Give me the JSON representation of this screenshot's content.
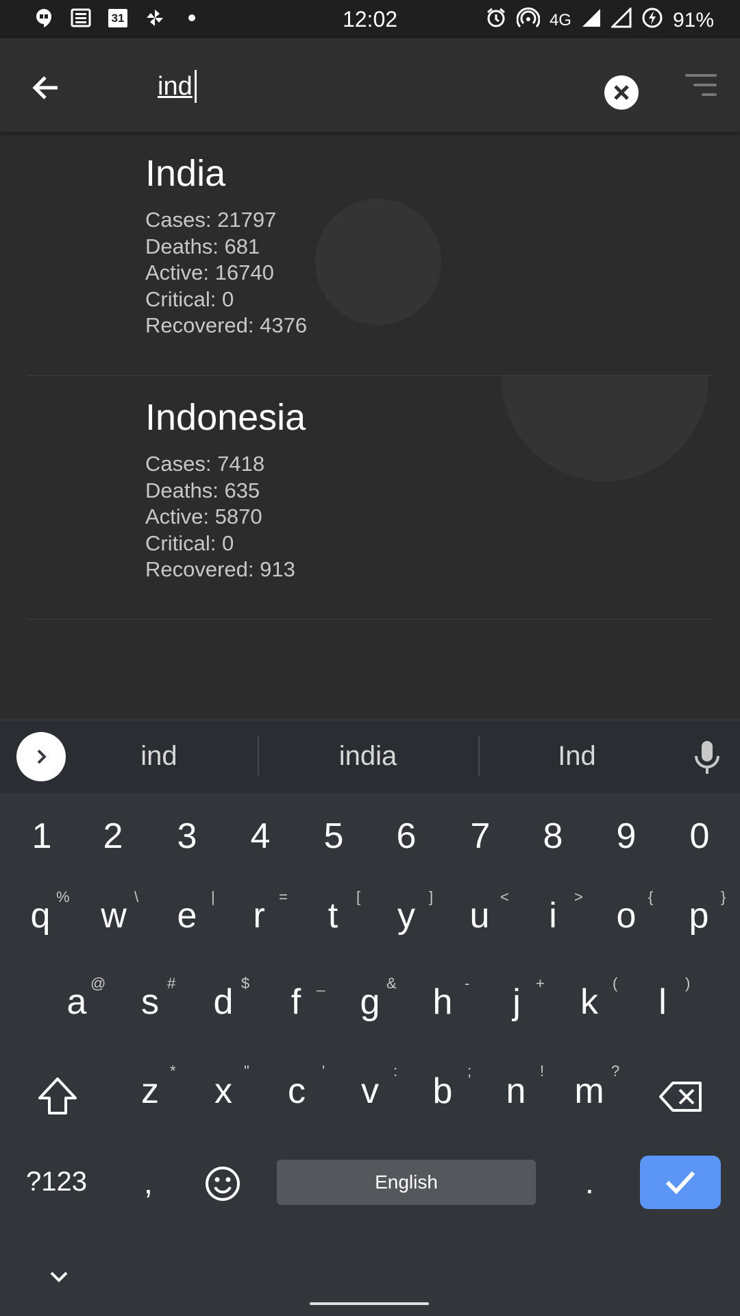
{
  "status_bar": {
    "time": "12:02",
    "network": "4G",
    "battery": "91%",
    "left_icons": [
      "hangouts-icon",
      "news-icon",
      "calendar-icon",
      "pinwheel-icon",
      "dot-icon"
    ],
    "calendar_day": "31"
  },
  "toolbar": {
    "search_value": "ind",
    "back_icon": "arrow-left-icon",
    "clear_icon": "close-circle-icon",
    "sort_icon": "sort-icon"
  },
  "results": [
    {
      "name": "India",
      "cases": "Cases: 21797",
      "deaths": "Deaths: 681",
      "active": "Active: 16740",
      "critical": "Critical: 0",
      "recovered": "Recovered: 4376"
    },
    {
      "name": "Indonesia",
      "cases": "Cases: 7418",
      "deaths": "Deaths: 635",
      "active": "Active: 5870",
      "critical": "Critical: 0",
      "recovered": "Recovered: 913"
    }
  ],
  "keyboard": {
    "suggestions": [
      "ind",
      "india",
      "Ind"
    ],
    "number_row": [
      "1",
      "2",
      "3",
      "4",
      "5",
      "6",
      "7",
      "8",
      "9",
      "0"
    ],
    "row1": [
      "q",
      "w",
      "e",
      "r",
      "t",
      "y",
      "u",
      "i",
      "o",
      "p"
    ],
    "row1_alts": [
      "%",
      "\\",
      "|",
      "=",
      "[",
      "]",
      "<",
      ">",
      "{",
      "}"
    ],
    "row2": [
      "a",
      "s",
      "d",
      "f",
      "g",
      "h",
      "j",
      "k",
      "l"
    ],
    "row2_alts": [
      "@",
      "#",
      "$",
      "_",
      "&",
      "-",
      "+",
      "(",
      ")"
    ],
    "row3": [
      "z",
      "x",
      "c",
      "v",
      "b",
      "n",
      "m"
    ],
    "row3_alts": [
      "*",
      "\"",
      "'",
      ":",
      ";",
      "!",
      "?"
    ],
    "symbols_key": "?123",
    "comma_key": ",",
    "period_key": ".",
    "space_label": "English",
    "accent_color": "#5b95f5"
  }
}
